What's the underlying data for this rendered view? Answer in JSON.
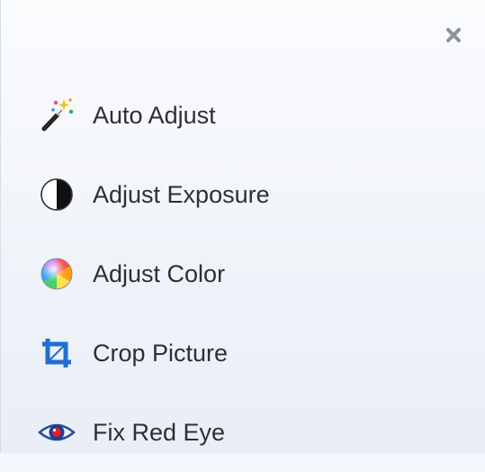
{
  "panel": {
    "close_label": "x",
    "items": [
      {
        "label": "Auto Adjust",
        "icon": "magic-wand-icon"
      },
      {
        "label": "Adjust Exposure",
        "icon": "contrast-icon"
      },
      {
        "label": "Adjust Color",
        "icon": "color-wheel-icon"
      },
      {
        "label": "Crop Picture",
        "icon": "crop-icon"
      },
      {
        "label": "Fix Red Eye",
        "icon": "red-eye-icon"
      }
    ]
  },
  "colors": {
    "background": "#f3f6fa",
    "text": "#2d2f33",
    "close": "#8b929b",
    "crop_icon": "#1f6fd1"
  }
}
